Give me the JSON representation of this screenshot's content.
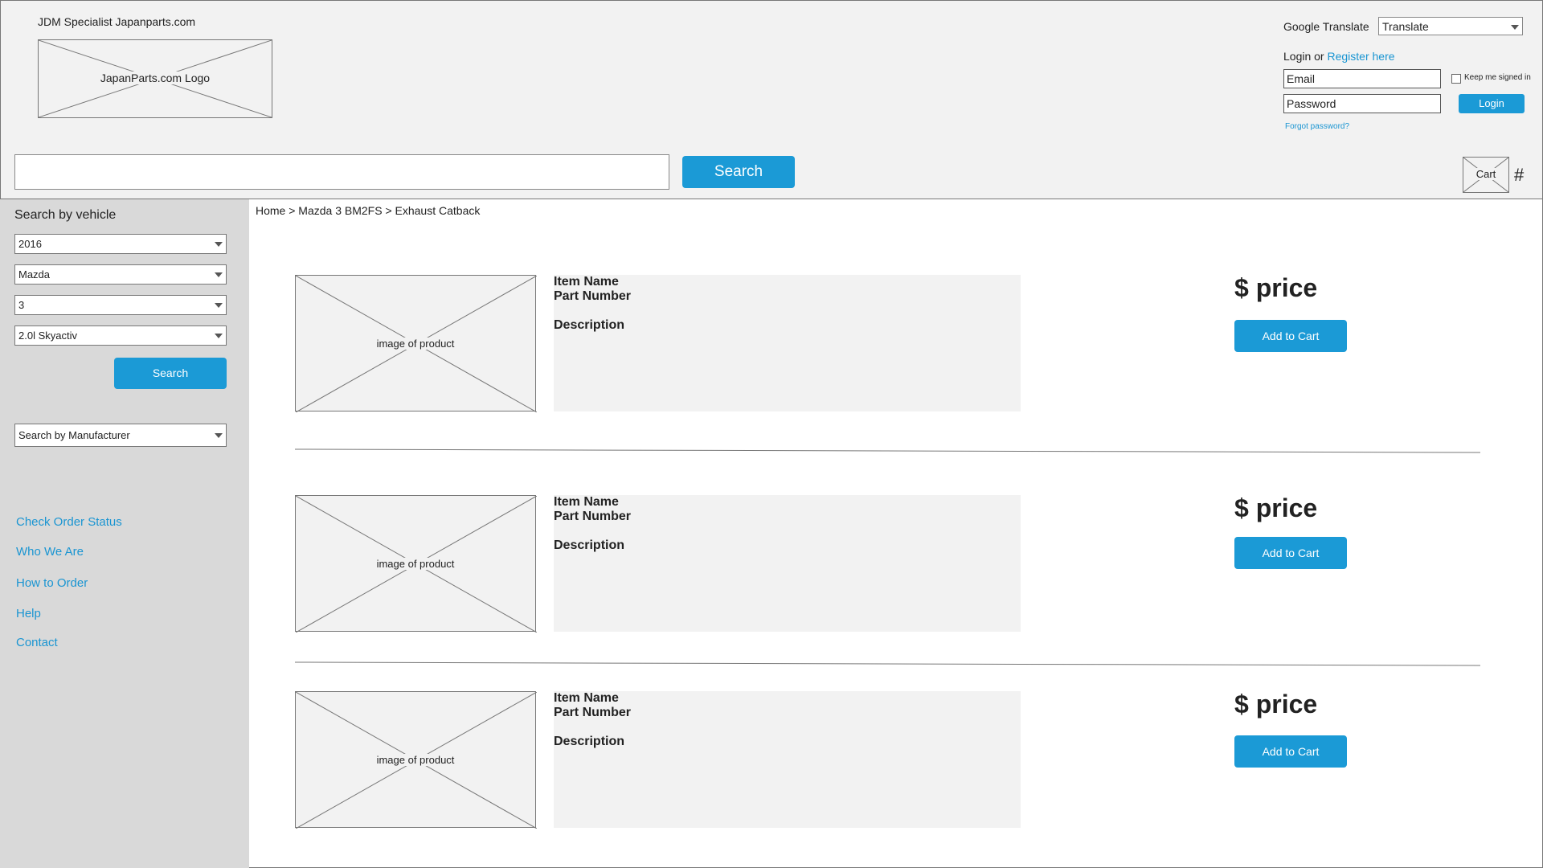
{
  "header": {
    "tagline": "JDM Specialist Japanparts.com",
    "logo_text": "JapanParts.com Logo",
    "google_translate_label": "Google Translate",
    "translate_value": "Translate",
    "login_prefix": "Login or",
    "register_link": "Register here",
    "email_placeholder": "Email",
    "password_placeholder": "Password",
    "keep_signed_in": "Keep me signed in",
    "login_button": "Login",
    "forgot_password": "Forgot password?"
  },
  "search": {
    "button": "Search",
    "cart_label": "Cart",
    "cart_count": "#"
  },
  "sidebar": {
    "title": "Search by vehicle",
    "year": "2016",
    "make": "Mazda",
    "model": "3",
    "engine": "2.0l Skyactiv",
    "search_button": "Search",
    "manufacturer": "Search by Manufacturer",
    "links": [
      "Check Order Status",
      "Who We Are",
      "How to Order",
      "Help",
      "Contact"
    ]
  },
  "breadcrumb": "Home > Mazda 3 BM2FS > Exhaust Catback",
  "products": [
    {
      "image_text": "image of product",
      "name": "Item Name",
      "part_number": "Part Number",
      "description": "Description",
      "price": "$ price",
      "button": "Add to Cart"
    },
    {
      "image_text": "image of product",
      "name": "Item Name",
      "part_number": "Part Number",
      "description": "Description",
      "price": "$ price",
      "button": "Add to Cart"
    },
    {
      "image_text": "image of product",
      "name": "Item Name",
      "part_number": "Part Number",
      "description": "Description",
      "price": "$ price",
      "button": "Add to Cart"
    }
  ],
  "colors": {
    "accent": "#1b9ad6",
    "link": "#1a95d2",
    "header_bg": "#f2f2f2",
    "sidebar_bg": "#d9d9d9"
  }
}
